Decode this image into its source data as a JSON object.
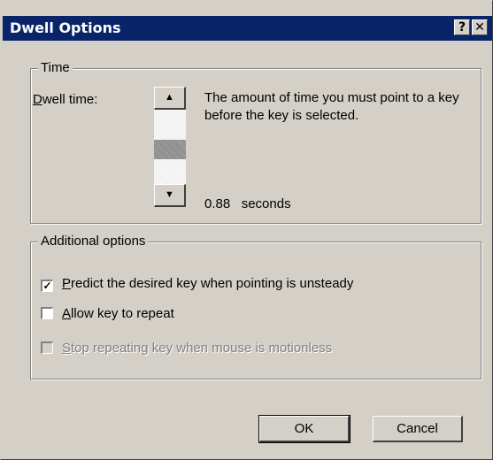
{
  "window": {
    "title": "Dwell Options",
    "help_glyph": "?",
    "close_glyph": "✕"
  },
  "time_group": {
    "legend": "Time",
    "dwell_label_first": "D",
    "dwell_label_rest": "well time:",
    "description": "The amount of time you must point to a key before the key is selected.",
    "value": "0.88",
    "unit": "seconds",
    "slider_position_fraction": 0.55
  },
  "additional_group": {
    "legend": "Additional options",
    "options": [
      {
        "first": "P",
        "rest": "redict the desired key when pointing is unsteady",
        "checked": true,
        "enabled": true
      },
      {
        "first": "A",
        "rest": "llow key to repeat",
        "checked": false,
        "enabled": true
      },
      {
        "first": "S",
        "rest": "top repeating key when mouse is motionless",
        "checked": false,
        "enabled": false
      }
    ]
  },
  "buttons": {
    "ok": "OK",
    "cancel": "Cancel"
  }
}
